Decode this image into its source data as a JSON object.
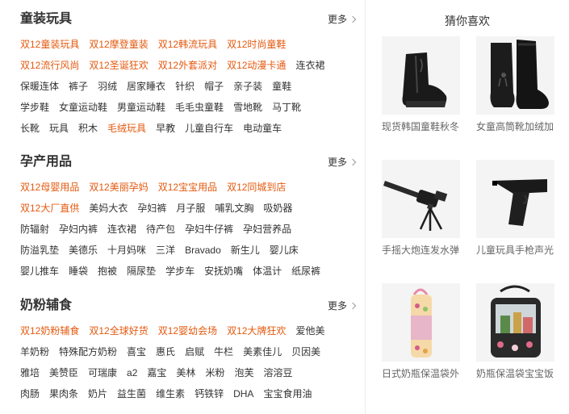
{
  "sections": [
    {
      "title": "童装玩具",
      "more": "更多",
      "rows": [
        [
          {
            "t": "双12童装玩具",
            "hot": true
          },
          {
            "t": "双12摩登童装",
            "hot": true
          },
          {
            "t": "双12韩流玩具",
            "hot": true
          },
          {
            "t": "双12时尚童鞋",
            "hot": true
          }
        ],
        [
          {
            "t": "双12流行风尚",
            "hot": true
          },
          {
            "t": "双12圣诞狂欢",
            "hot": true
          },
          {
            "t": "双12外套派对",
            "hot": true
          },
          {
            "t": "双12动漫卡通",
            "hot": true
          },
          {
            "t": "连衣裙"
          }
        ],
        [
          {
            "t": "保暖连体"
          },
          {
            "t": "裤子"
          },
          {
            "t": "羽绒"
          },
          {
            "t": "居家睡衣"
          },
          {
            "t": "针织"
          },
          {
            "t": "帽子"
          },
          {
            "t": "亲子装"
          },
          {
            "t": "童鞋"
          }
        ],
        [
          {
            "t": "学步鞋"
          },
          {
            "t": "女童运动鞋"
          },
          {
            "t": "男童运动鞋"
          },
          {
            "t": "毛毛虫童鞋"
          },
          {
            "t": "雪地靴"
          },
          {
            "t": "马丁靴"
          }
        ],
        [
          {
            "t": "长靴"
          },
          {
            "t": "玩具"
          },
          {
            "t": "积木"
          },
          {
            "t": "毛绒玩具",
            "hot": true
          },
          {
            "t": "早教"
          },
          {
            "t": "儿童自行车"
          },
          {
            "t": "电动童车"
          }
        ]
      ]
    },
    {
      "title": "孕产用品",
      "more": "更多",
      "rows": [
        [
          {
            "t": "双12母婴用品",
            "hot": true
          },
          {
            "t": "双12美丽孕妈",
            "hot": true
          },
          {
            "t": "双12宝宝用品",
            "hot": true
          },
          {
            "t": "双12同城到店",
            "hot": true
          }
        ],
        [
          {
            "t": "双12大厂直供",
            "hot": true
          },
          {
            "t": "美妈大衣"
          },
          {
            "t": "孕妇裤"
          },
          {
            "t": "月子服"
          },
          {
            "t": "哺乳文胸"
          },
          {
            "t": "吸奶器"
          }
        ],
        [
          {
            "t": "防辐射"
          },
          {
            "t": "孕妇内裤"
          },
          {
            "t": "连衣裙"
          },
          {
            "t": "待产包"
          },
          {
            "t": "孕妇牛仔裤"
          },
          {
            "t": "孕妇营养品"
          }
        ],
        [
          {
            "t": "防溢乳垫"
          },
          {
            "t": "美德乐"
          },
          {
            "t": "十月妈咪"
          },
          {
            "t": "三洋"
          },
          {
            "t": "Bravado"
          },
          {
            "t": "新生儿"
          },
          {
            "t": "婴儿床"
          }
        ],
        [
          {
            "t": "婴儿推车"
          },
          {
            "t": "睡袋"
          },
          {
            "t": "抱被"
          },
          {
            "t": "隔尿垫"
          },
          {
            "t": "学步车"
          },
          {
            "t": "安抚奶嘴"
          },
          {
            "t": "体温计"
          },
          {
            "t": "纸尿裤"
          }
        ]
      ]
    },
    {
      "title": "奶粉辅食",
      "more": "更多",
      "rows": [
        [
          {
            "t": "双12奶粉辅食",
            "hot": true
          },
          {
            "t": "双12全球好货",
            "hot": true
          },
          {
            "t": "双12婴幼会场",
            "hot": true
          },
          {
            "t": "双12大牌狂欢",
            "hot": true
          },
          {
            "t": "爱他美"
          }
        ],
        [
          {
            "t": "羊奶粉"
          },
          {
            "t": "特殊配方奶粉"
          },
          {
            "t": "喜宝"
          },
          {
            "t": "惠氏"
          },
          {
            "t": "启赋"
          },
          {
            "t": "牛栏"
          },
          {
            "t": "美素佳儿"
          },
          {
            "t": "贝因美"
          }
        ],
        [
          {
            "t": "雅培"
          },
          {
            "t": "美赞臣"
          },
          {
            "t": "可瑞康"
          },
          {
            "t": "a2"
          },
          {
            "t": "嘉宝"
          },
          {
            "t": "美林"
          },
          {
            "t": "米粉"
          },
          {
            "t": "泡芙"
          },
          {
            "t": "溶溶豆"
          }
        ],
        [
          {
            "t": "肉肠"
          },
          {
            "t": "果肉条"
          },
          {
            "t": "奶片"
          },
          {
            "t": "益生菌"
          },
          {
            "t": "维生素"
          },
          {
            "t": "钙铁锌"
          },
          {
            "t": "DHA"
          },
          {
            "t": "宝宝食用油"
          }
        ]
      ]
    }
  ],
  "recommend": {
    "title": "猜你喜欢",
    "items": [
      {
        "name": "现货韩国童鞋秋冬",
        "icon": "ankle-boot-image"
      },
      {
        "name": "女童高筒靴加绒加",
        "icon": "tall-boot-image"
      },
      {
        "name": "手摇大炮连发水弹",
        "icon": "toy-cannon-image"
      },
      {
        "name": "儿童玩具手枪声光",
        "icon": "toy-pistol-image"
      },
      {
        "name": "日式奶瓶保温袋外",
        "icon": "bottle-bag-image"
      },
      {
        "name": "奶瓶保温袋宝宝饭",
        "icon": "cooler-bag-image"
      }
    ]
  },
  "colors": {
    "hot": "#e4590f",
    "text": "#333333",
    "muted": "#666666"
  }
}
